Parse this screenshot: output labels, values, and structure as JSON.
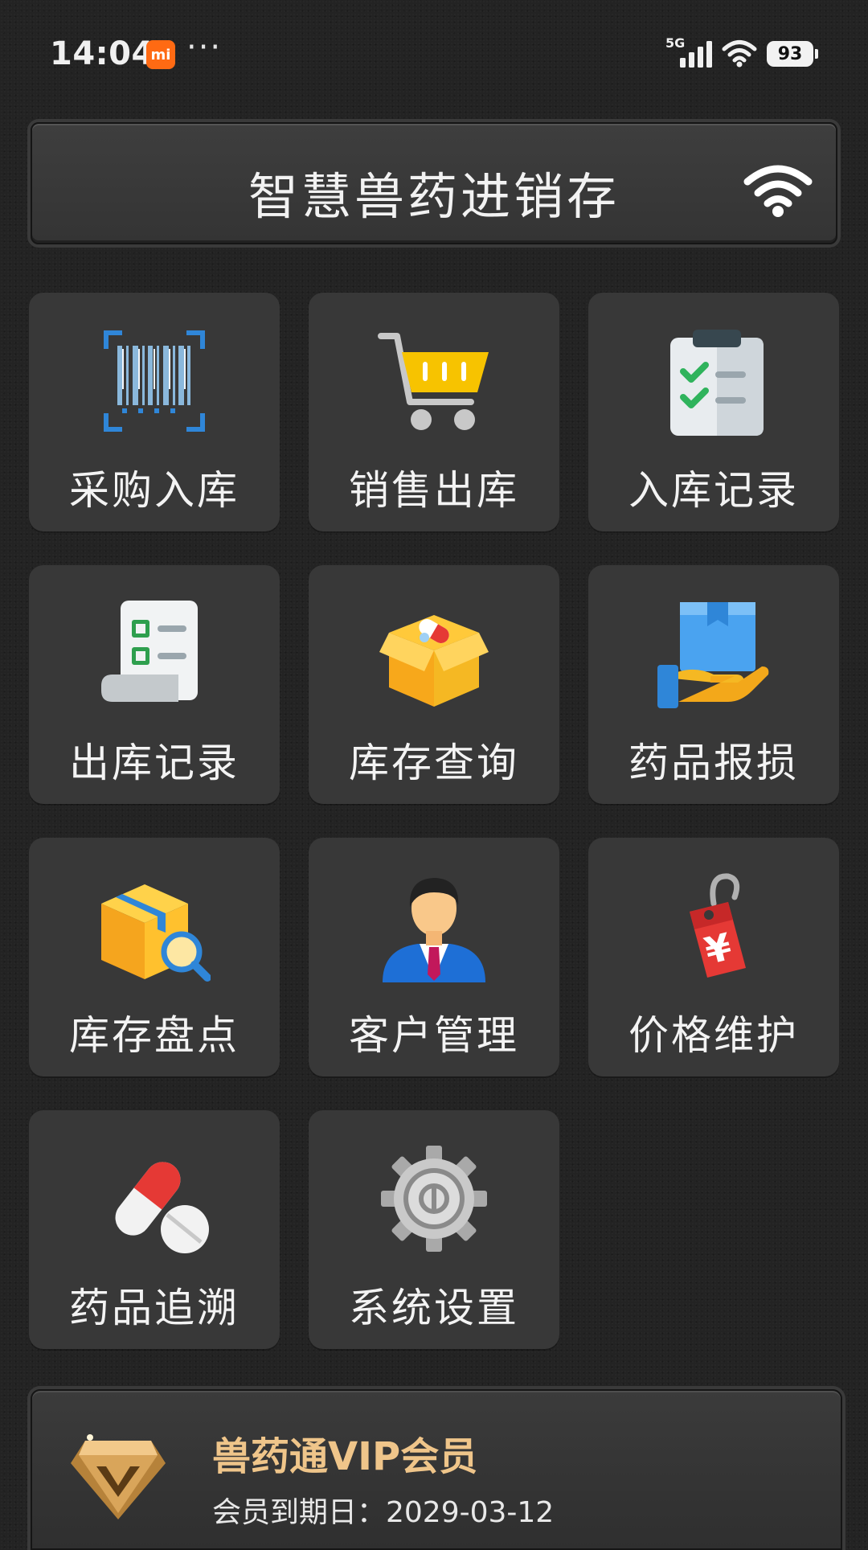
{
  "status_bar": {
    "time": "14:04",
    "mi_badge": "mi",
    "dots": "···",
    "network": "5G",
    "battery": "93"
  },
  "header": {
    "title": "智慧兽药进销存",
    "icon": "wifi-icon"
  },
  "menu": [
    {
      "label": "采购入库",
      "icon": "barcode-scan-icon"
    },
    {
      "label": "销售出库",
      "icon": "shopping-cart-icon"
    },
    {
      "label": "入库记录",
      "icon": "clipboard-checklist-icon"
    },
    {
      "label": "出库记录",
      "icon": "receipt-list-icon"
    },
    {
      "label": "库存查询",
      "icon": "medicine-box-icon"
    },
    {
      "label": "药品报损",
      "icon": "box-in-hand-icon"
    },
    {
      "label": "库存盘点",
      "icon": "box-magnifier-icon"
    },
    {
      "label": "客户管理",
      "icon": "customer-person-icon"
    },
    {
      "label": "价格维护",
      "icon": "yuan-price-tag-icon"
    },
    {
      "label": "药品追溯",
      "icon": "pills-icon"
    },
    {
      "label": "系统设置",
      "icon": "gear-icon"
    }
  ],
  "vip": {
    "title": "兽药通VIP会员",
    "expiry": "会员到期日：2029-03-12",
    "icon": "vip-diamond-icon"
  },
  "colors": {
    "background": "#232323",
    "tile": "#383838",
    "vip_gold": "#efc58a",
    "cart_yellow": "#f7c300",
    "check_green": "#2fb35c",
    "tag_red": "#e53935"
  }
}
